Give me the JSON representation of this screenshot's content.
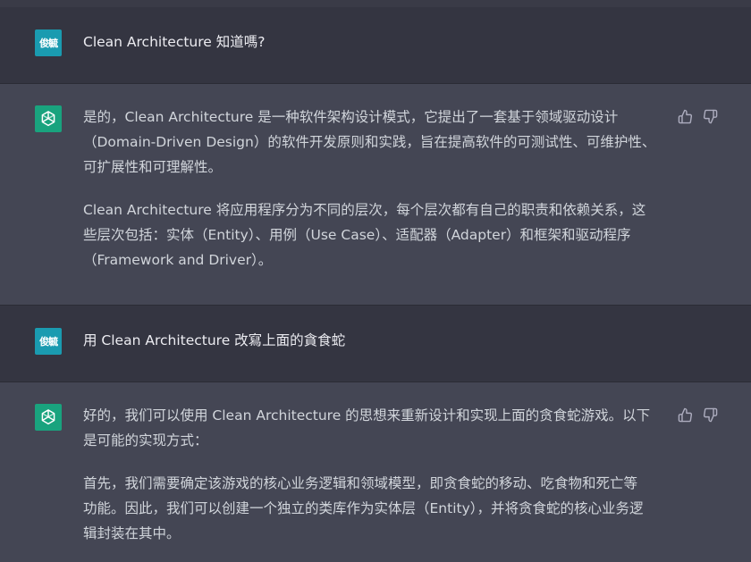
{
  "conversation": {
    "messages": [
      {
        "role": "user",
        "avatar_text": "俊毓",
        "text": "Clean Architecture 知道嗎?"
      },
      {
        "role": "assistant",
        "avatar_icon": "openai-logo-icon",
        "paragraphs": [
          {
            "lines": [
              "是的，Clean Architecture 是一种软件架构设计模式，它提出了一套基于领域驱动设计",
              "（Domain-Driven Design）的软件开发原则和实践，旨在提高软件的可测试性、可维护性、",
              "可扩展性和可理解性。"
            ]
          },
          {
            "lines": [
              "Clean Architecture 将应用程序分为不同的层次，每个层次都有自己的职责和依赖关系，这",
              "些层次包括：实体（Entity）、用例（Use Case）、适配器（Adapter）和框架和驱动程序",
              "（Framework and Driver）。"
            ]
          }
        ]
      },
      {
        "role": "user",
        "avatar_text": "俊毓",
        "text": "用 Clean Architecture  改寫上面的貪食蛇"
      },
      {
        "role": "assistant",
        "avatar_icon": "openai-logo-icon",
        "paragraphs": [
          {
            "lines": [
              "好的，我们可以使用 Clean Architecture 的思想来重新设计和实现上面的贪食蛇游戏。以下",
              "是可能的实现方式："
            ]
          },
          {
            "lines": [
              "首先，我们需要确定该游戏的核心业务逻辑和领域模型，即贪食蛇的移动、吃食物和死亡等",
              "功能。因此，我们可以创建一个独立的类库作为实体层（Entity），并将贪食蛇的核心业务逻",
              "辑封装在其中。"
            ]
          }
        ]
      }
    ]
  },
  "icons": {
    "thumbs_up": "thumbs-up-icon",
    "thumbs_down": "thumbs-down-icon"
  },
  "colors": {
    "user_bg": "#343541",
    "assistant_bg": "#444654",
    "user_avatar": "#1a9bb0",
    "bot_avatar": "#19a37e"
  }
}
